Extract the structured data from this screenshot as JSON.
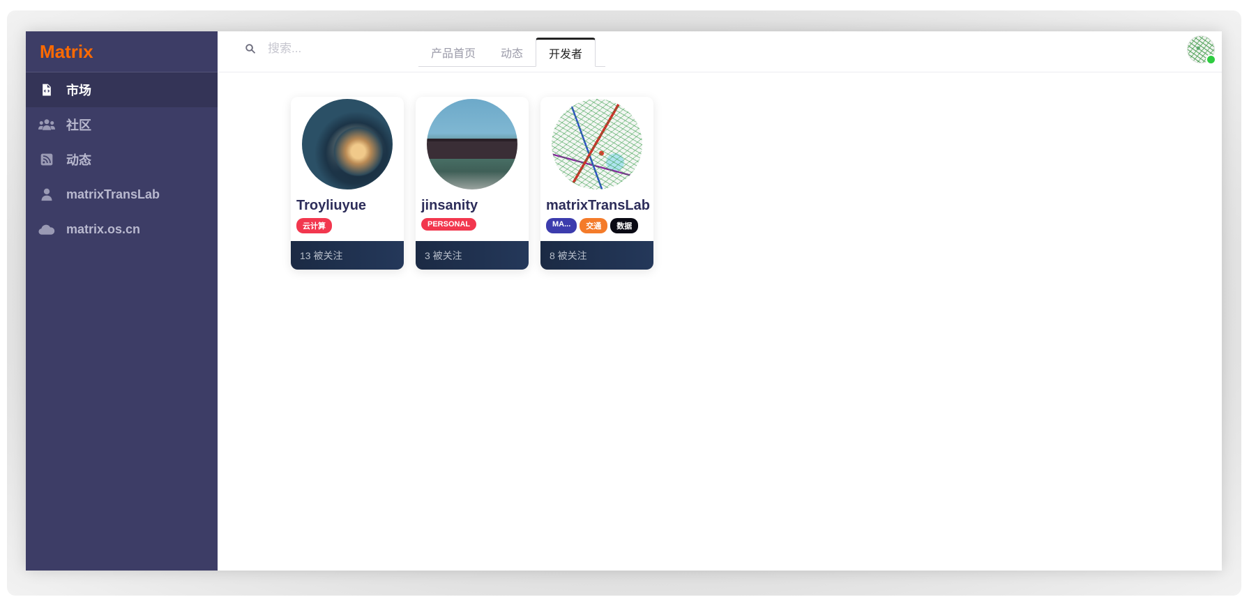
{
  "brand": {
    "name": "Matrix",
    "color": "#ff6a00"
  },
  "sidebar": {
    "items": [
      {
        "label": "市场",
        "icon": "code-file-icon",
        "active": true
      },
      {
        "label": "社区",
        "icon": "users-icon",
        "active": false
      },
      {
        "label": "动态",
        "icon": "rss-icon",
        "active": false
      },
      {
        "label": "matrixTransLab",
        "icon": "user-icon",
        "active": false
      },
      {
        "label": "matrix.os.cn",
        "icon": "cloud-icon",
        "active": false
      }
    ]
  },
  "header": {
    "search": {
      "placeholder": "搜索...",
      "value": ""
    },
    "tabs": [
      {
        "label": "产品首页",
        "active": false
      },
      {
        "label": "动态",
        "active": false
      },
      {
        "label": "开发者",
        "active": true
      }
    ],
    "avatar": {
      "icon": "user-avatar",
      "online": true
    }
  },
  "developers": [
    {
      "name": "Troyliuyue",
      "image": "wave-photo",
      "badges": [
        {
          "label": "云计算",
          "color": "#f2374e"
        }
      ],
      "followers": "13 被关注"
    },
    {
      "name": "jinsanity",
      "image": "van-photo",
      "badges": [
        {
          "label": "PERSONAL",
          "color": "#f2374e"
        }
      ],
      "followers": "3 被关注"
    },
    {
      "name": "matrixTransLab",
      "image": "transit-map",
      "badges": [
        {
          "label": "MA...",
          "color": "#3c3cad"
        },
        {
          "label": "交通",
          "color": "#f47b2a"
        },
        {
          "label": "数据",
          "color": "#0a0a14"
        }
      ],
      "followers": "8 被关注"
    }
  ]
}
